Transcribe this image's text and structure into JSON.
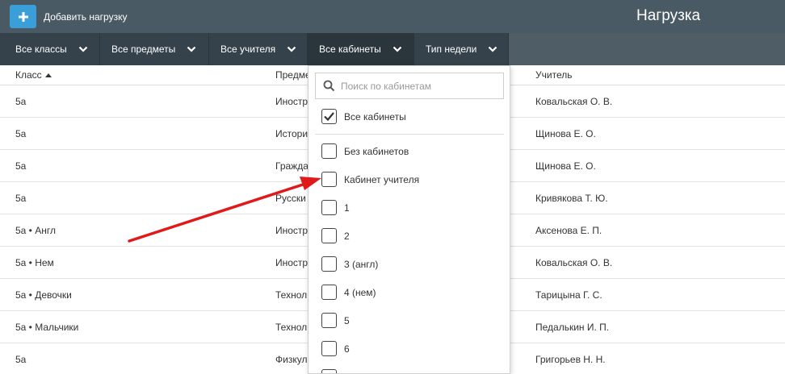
{
  "header": {
    "add_button_label": "Добавить нагрузку",
    "title": "Нагрузка"
  },
  "filters": [
    {
      "label": "Все классы"
    },
    {
      "label": "Все предметы"
    },
    {
      "label": "Все учителя"
    },
    {
      "label": "Все кабинеты"
    },
    {
      "label": "Тип недели"
    }
  ],
  "table": {
    "columns": [
      "Класс",
      "Предмет",
      "Учитель"
    ],
    "rows": [
      {
        "class": "5а",
        "subject": "Иностр",
        "teacher": "Ковальская О. В."
      },
      {
        "class": "5а",
        "subject": "Истори",
        "teacher": "Щинова Е. О."
      },
      {
        "class": "5а",
        "subject": "Гражда",
        "teacher": "Щинова Е. О."
      },
      {
        "class": "5а",
        "subject": "Русски",
        "teacher": "Кривякова Т. Ю."
      },
      {
        "class": "5а • Англ",
        "subject": "Иностр",
        "teacher": "Аксенова Е. П."
      },
      {
        "class": "5а • Нем",
        "subject": "Иностр",
        "teacher": "Ковальская О. В."
      },
      {
        "class": "5а • Девочки",
        "subject": "Технол",
        "teacher": "Тарицына Г. С."
      },
      {
        "class": "5а • Мальчики",
        "subject": "Технол",
        "teacher": "Педалькин И. П."
      },
      {
        "class": "5а",
        "subject": "Физкул",
        "teacher": "Григорьев Н. Н."
      }
    ]
  },
  "dropdown": {
    "search_placeholder": "Поиск по кабинетам",
    "all_option": {
      "label": "Все кабинеты",
      "checked": true
    },
    "options": [
      {
        "label": "Без кабинетов",
        "checked": false
      },
      {
        "label": "Кабинет учителя",
        "checked": false
      },
      {
        "label": "1",
        "checked": false
      },
      {
        "label": "2",
        "checked": false
      },
      {
        "label": "3 (англ)",
        "checked": false
      },
      {
        "label": "4 (нем)",
        "checked": false
      },
      {
        "label": "5",
        "checked": false
      },
      {
        "label": "6",
        "checked": false
      },
      {
        "label": "",
        "checked": false
      }
    ]
  },
  "colors": {
    "topbar": "#4a5a65",
    "filterbar": "#35424b",
    "accent": "#3a9fd8",
    "annotation_arrow": "#e01a1a"
  }
}
